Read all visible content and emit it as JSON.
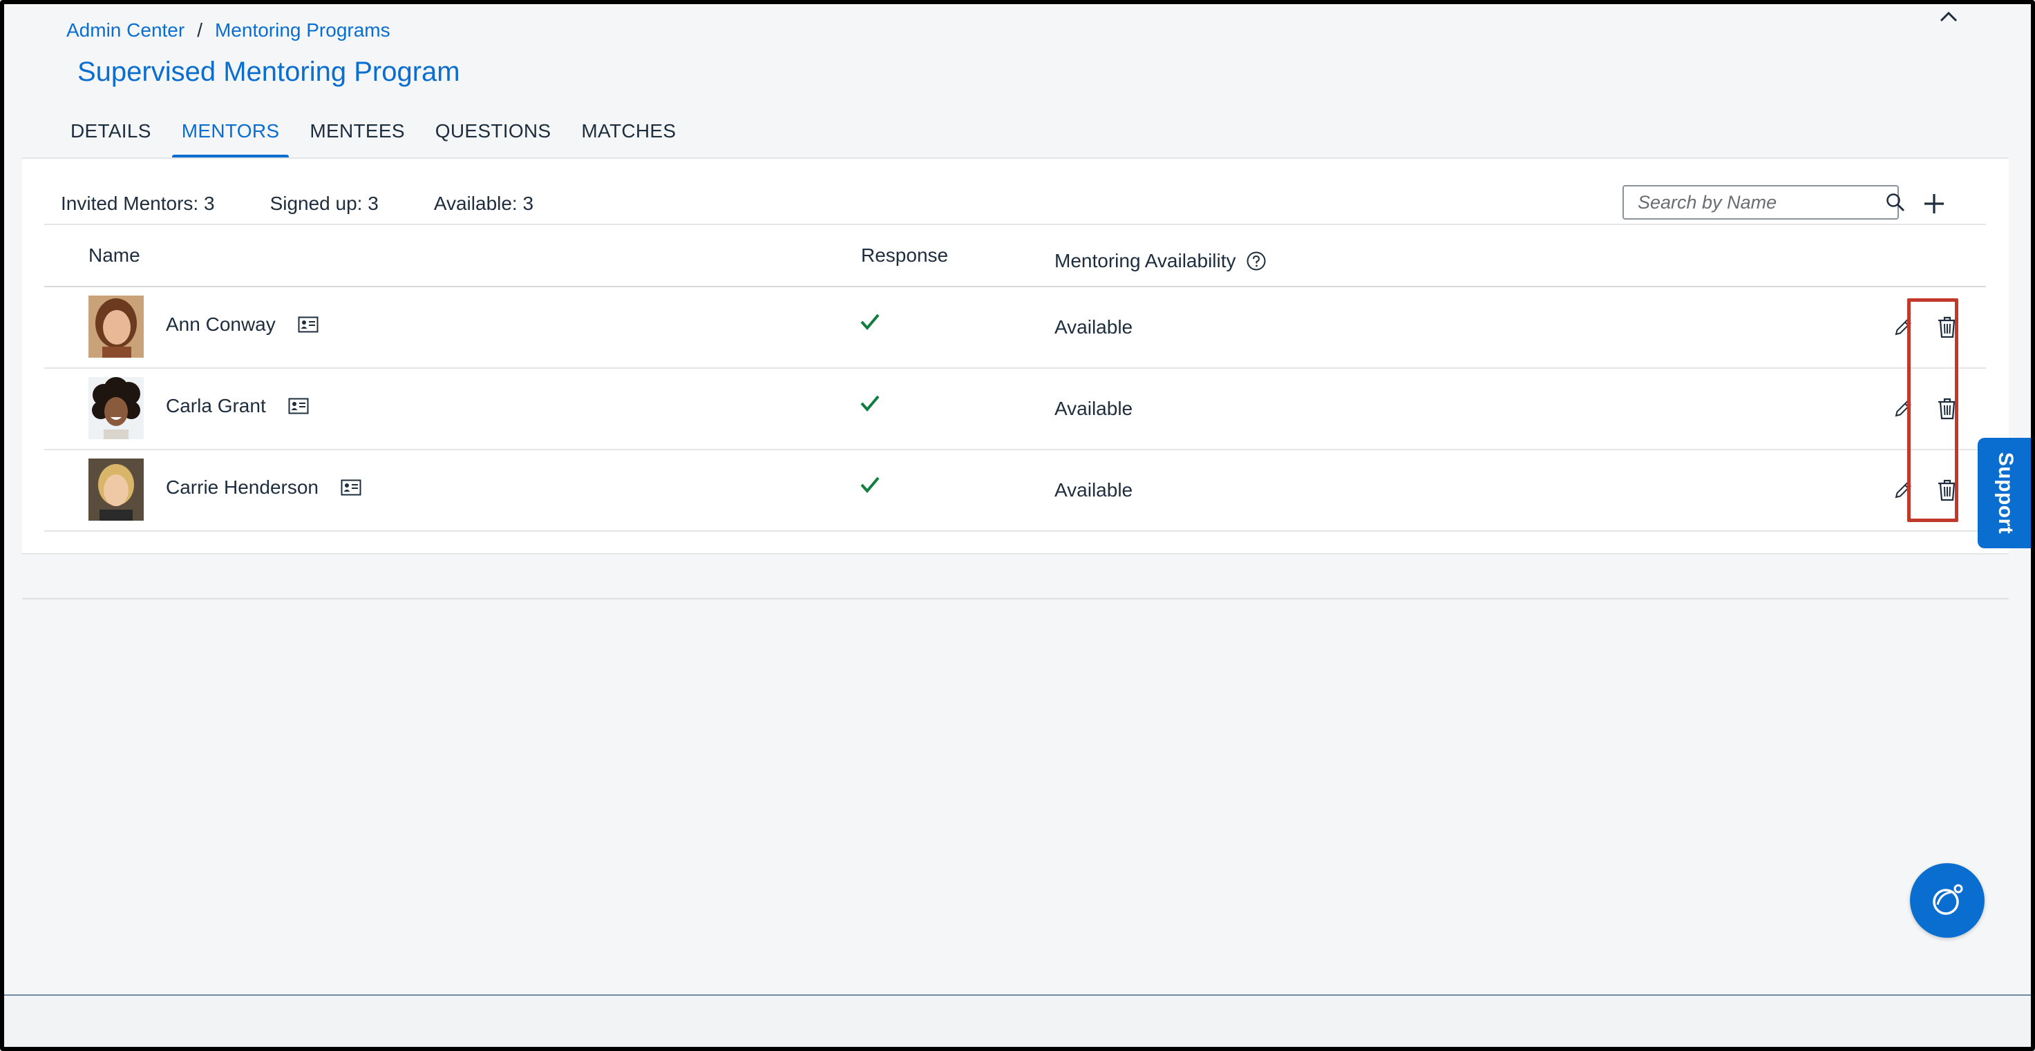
{
  "breadcrumb": {
    "items": [
      {
        "label": "Admin Center"
      },
      {
        "label": "Mentoring Programs"
      }
    ],
    "separator": "/"
  },
  "page_title": "Supervised Mentoring Program",
  "tabs": [
    {
      "label": "DETAILS",
      "active": false
    },
    {
      "label": "MENTORS",
      "active": true
    },
    {
      "label": "MENTEES",
      "active": false
    },
    {
      "label": "QUESTIONS",
      "active": false
    },
    {
      "label": "MATCHES",
      "active": false
    }
  ],
  "stats": {
    "invited": "Invited Mentors: 3",
    "signed_up": "Signed up: 3",
    "available": "Available: 3"
  },
  "search": {
    "placeholder": "Search by Name",
    "value": ""
  },
  "table": {
    "headers": {
      "name": "Name",
      "response": "Response",
      "availability": "Mentoring Availability"
    },
    "rows": [
      {
        "name": "Ann Conway",
        "response": "accepted",
        "availability": "Available"
      },
      {
        "name": "Carla Grant",
        "response": "accepted",
        "availability": "Available"
      },
      {
        "name": "Carrie Henderson",
        "response": "accepted",
        "availability": "Available"
      }
    ]
  },
  "support_label": "Support",
  "colors": {
    "accent": "#0a6ed1",
    "check": "#107e3e",
    "highlight": "#c0392b",
    "text": "#1d2d3e"
  },
  "icons": {
    "collapse": "chevron-up-icon",
    "search": "search-icon",
    "add": "plus-icon",
    "help": "help-circle-icon",
    "contact": "contact-card-icon",
    "response": "checkmark-icon",
    "edit": "pencil-icon",
    "delete": "trash-icon",
    "assistant": "joule-assistant-icon"
  }
}
